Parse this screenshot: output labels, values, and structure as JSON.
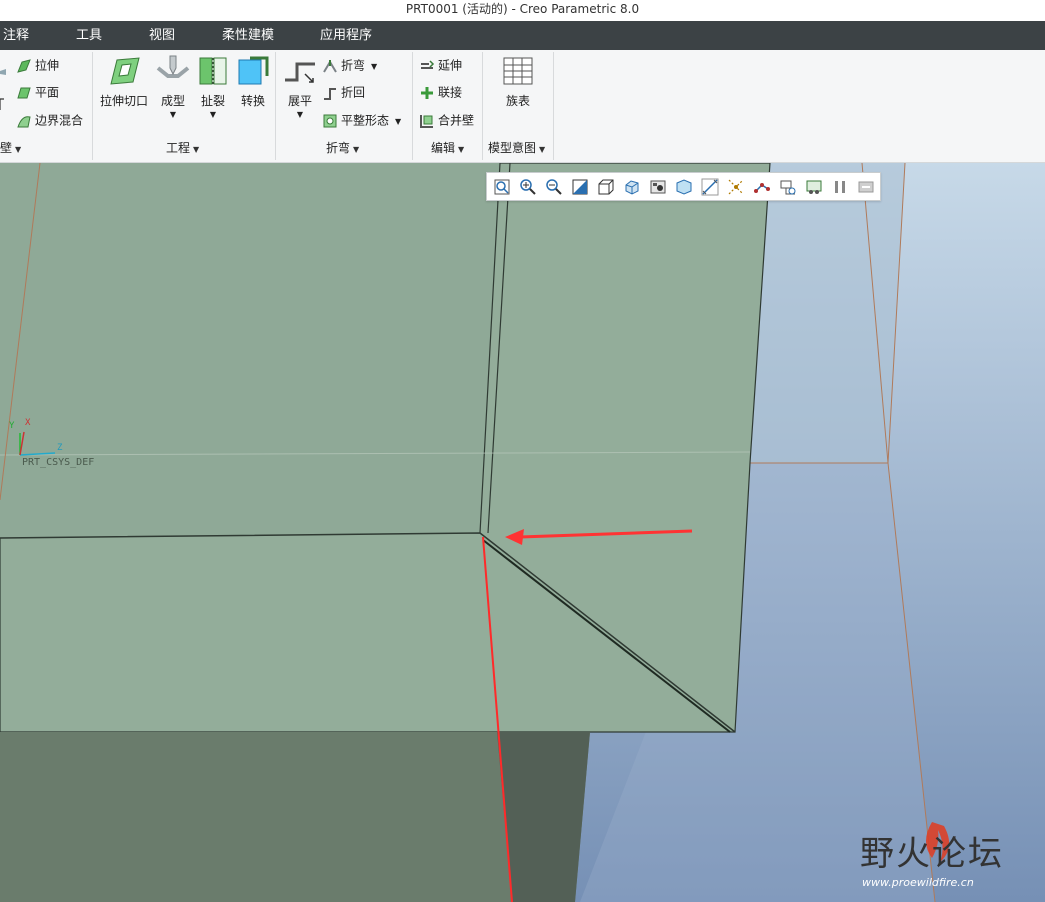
{
  "window": {
    "title": "PRT0001 (活动的) - Creo Parametric 8.0"
  },
  "menu": [
    "注释",
    "工具",
    "视图",
    "柔性建模",
    "应用程序"
  ],
  "ribbon": {
    "wall": {
      "buttons": [
        "拉伸",
        "平面",
        "边界混合"
      ],
      "group_label": "壁"
    },
    "engineering": {
      "buttons": [
        "拉伸切口",
        "成型",
        "扯裂",
        "转换"
      ],
      "group_label": "工程"
    },
    "bend": {
      "big_button": "展平",
      "buttons": [
        "折弯",
        "折回",
        "平整形态"
      ],
      "group_label": "折弯"
    },
    "edit": {
      "buttons": [
        "延伸",
        "联接",
        "合并壁"
      ],
      "group_label": "编辑"
    },
    "model_intent": {
      "big_button": "族表",
      "group_label": "模型意图"
    }
  },
  "view_toolbar": {
    "icons": [
      "refit-icon",
      "zoom-in-icon",
      "zoom-out-icon",
      "repaint-icon",
      "display-style-icon",
      "saved-orientations-icon",
      "view-manager-icon",
      "perspective-icon",
      "plane-display-icon",
      "axis-display-icon",
      "point-display-icon",
      "csys-display-icon",
      "annotation-display-icon",
      "pause-icon",
      "spin-center-icon"
    ]
  },
  "canvas": {
    "csys_label": "PRT_CSYS_DEF",
    "axis_x": "X",
    "axis_y": "Y",
    "axis_z": "Z",
    "colors": {
      "sheet_face": "#93ad9a",
      "sheet_dark": "#6a7c6c",
      "background_top": "#c7d9e8",
      "background_bottom": "#7690b5",
      "highlight_edge": "#ff2a2a",
      "arrow": "#ff3333"
    }
  },
  "watermark": {
    "brand": "野火论坛",
    "url": "www.proewildfire.cn"
  }
}
